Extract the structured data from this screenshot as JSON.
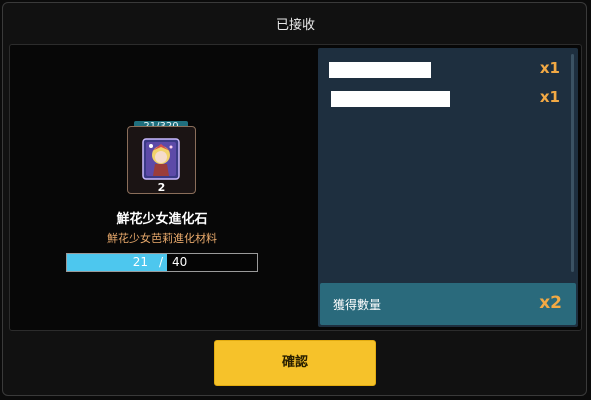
{
  "dialog": {
    "title": "已接收"
  },
  "item": {
    "stock_count": "21/320",
    "quantity": "2",
    "name": "鮮花少女進化石",
    "description": "鮮花少女芭莉進化材料",
    "icon": "flower-girl-evolution-stone-icon",
    "progress": {
      "current": "21",
      "separator": "/",
      "max": "40",
      "fraction": 0.525
    }
  },
  "rewards": [
    {
      "name": "",
      "quantity": "x1"
    },
    {
      "name": "",
      "quantity": "x1"
    }
  ],
  "total": {
    "label": "獲得數量",
    "value": "x2"
  },
  "confirm_label": "確認",
  "colors": {
    "accent_orange": "#f2a944",
    "progress_blue": "#4dc7ee",
    "confirm_yellow": "#f6c22a",
    "list_background": "#1e2f3f",
    "total_bar": "#2a6a7c"
  }
}
